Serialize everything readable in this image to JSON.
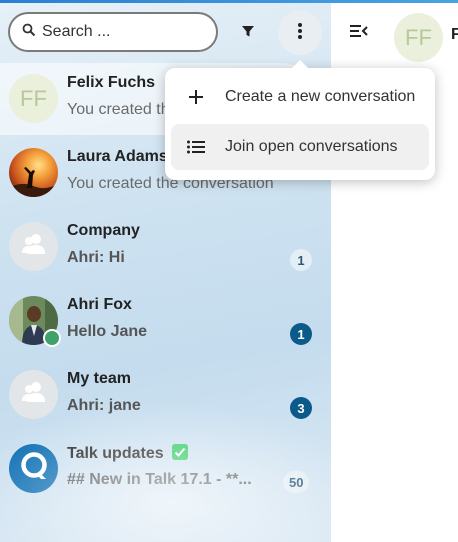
{
  "search": {
    "placeholder": "Search ..."
  },
  "toolbar": {
    "filter_icon": "filter-icon",
    "more_icon": "more-vertical-icon"
  },
  "conversations": [
    {
      "title": "Felix Fuchs",
      "subtitle": "You created the conversation",
      "avatar_initials": "FF",
      "avatar_type": "initials"
    },
    {
      "title": "Laura Adams",
      "subtitle": "You created the conversation",
      "avatar_type": "photo-sunset"
    },
    {
      "title": "Company",
      "subtitle": "Ahri: Hi",
      "unread": "1",
      "badge_style": "light",
      "avatar_type": "group"
    },
    {
      "title": "Ahri Fox",
      "subtitle": "Hello Jane",
      "unread": "1",
      "badge_style": "dark",
      "avatar_type": "photo-person",
      "status": "online"
    },
    {
      "title": "My team",
      "subtitle": "Ahri: jane",
      "unread": "3",
      "badge_style": "dark",
      "avatar_type": "group"
    },
    {
      "title": "Talk updates",
      "subtitle": "## New in Talk 17.1 - **...",
      "unread": "50",
      "badge_style": "light",
      "avatar_type": "talk-logo",
      "verified": true
    }
  ],
  "menu": {
    "items": [
      {
        "label": "Create a new conversation",
        "icon": "plus-icon"
      },
      {
        "label": "Join open conversations",
        "icon": "list-icon"
      }
    ]
  },
  "main_header": {
    "avatar_initials": "FF",
    "title": "F"
  },
  "colors": {
    "accent": "#0a5a8a",
    "online": "#3fa26b",
    "verified": "#2fcc63"
  }
}
